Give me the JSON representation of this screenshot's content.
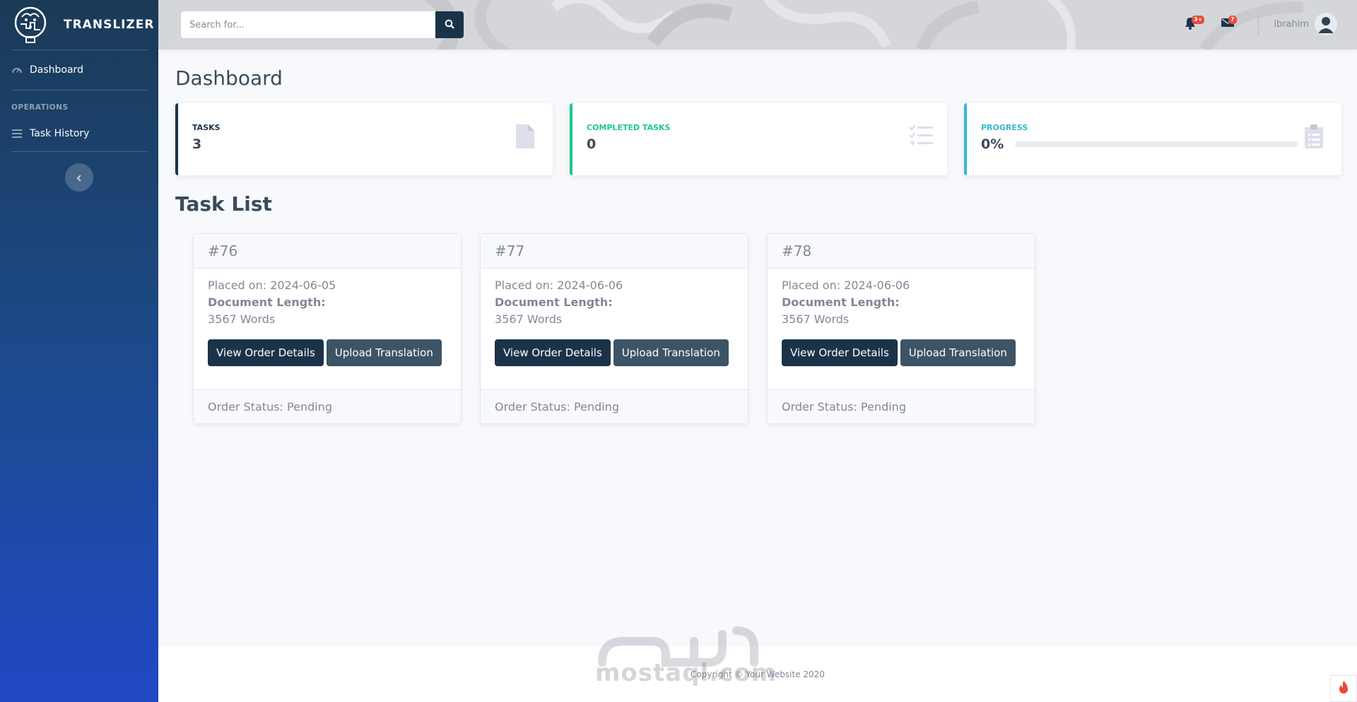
{
  "brand": {
    "name": "TRANSLIZER"
  },
  "sidebar": {
    "items": [
      {
        "label": "Dashboard",
        "icon": "tachometer-icon"
      },
      {
        "label": "Task History",
        "icon": "list-icon"
      }
    ],
    "heading": "OPERATIONS"
  },
  "topbar": {
    "search_placeholder": "Search for...",
    "alerts_badge": "3+",
    "messages_badge": "7",
    "user_name": "ibrahim"
  },
  "main": {
    "title": "Dashboard",
    "stats": [
      {
        "label": "TASKS",
        "value": "3"
      },
      {
        "label": "COMPLETED TASKS",
        "value": "0"
      },
      {
        "label": "PROGRESS",
        "value": "0%",
        "progress_fraction": 0
      }
    ],
    "task_list_title": "Task List",
    "tasks": [
      {
        "id": "#76",
        "placed": "Placed on: 2024-06-05",
        "doc_length_label": "Document Length:",
        "doc_length": "3567 Words",
        "view_btn": "View Order Details",
        "upload_btn": "Upload Translation",
        "status": "Order Status: Pending"
      },
      {
        "id": "#77",
        "placed": "Placed on: 2024-06-06",
        "doc_length_label": "Document Length:",
        "doc_length": "3567 Words",
        "view_btn": "View Order Details",
        "upload_btn": "Upload Translation",
        "status": "Order Status: Pending"
      },
      {
        "id": "#78",
        "placed": "Placed on: 2024-06-06",
        "doc_length_label": "Document Length:",
        "doc_length": "3567 Words",
        "view_btn": "View Order Details",
        "upload_btn": "Upload Translation",
        "status": "Order Status: Pending"
      }
    ]
  },
  "footer": {
    "copyright": "Copyright © Your Website 2020"
  },
  "watermark": {
    "text": "mostaql.com"
  },
  "colors": {
    "primary": "#1b3349",
    "success": "#1cc88a",
    "info": "#36b9cc",
    "danger": "#e74a3b"
  }
}
